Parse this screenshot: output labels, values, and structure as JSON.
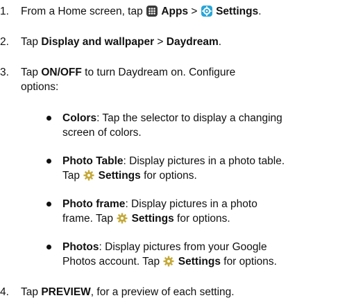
{
  "steps": [
    {
      "num": "1.",
      "parts": {
        "a": "From a Home screen, tap ",
        "apps": "Apps",
        "sep": " > ",
        "settings": "Settings",
        "end": "."
      }
    },
    {
      "num": "2.",
      "parts": {
        "a": "Tap ",
        "display": "Display and wallpaper",
        "sep": " > ",
        "daydream": "Daydream",
        "end": "."
      }
    },
    {
      "num": "3.",
      "parts": {
        "a": "Tap ",
        "onoff": "ON/OFF",
        "b": " to turn Daydream on. Configure",
        "c": "options:"
      }
    },
    {
      "num": "4.",
      "parts": {
        "a": "Tap ",
        "preview": "PREVIEW",
        "b": ", for a preview of each setting."
      }
    }
  ],
  "bullets": [
    {
      "term": "Colors",
      "line1": ": Tap the selector to display a changing",
      "line2": "screen of colors."
    },
    {
      "term": "Photo Table",
      "line1": ": Display pictures in a photo table.",
      "pre": "Tap ",
      "settings": "Settings",
      "post": " for options."
    },
    {
      "term": "Photo frame",
      "line1": ": Display pictures in a photo",
      "pre": "frame. Tap ",
      "settings": "Settings",
      "post": " for options."
    },
    {
      "term": "Photos",
      "line1": ": Display pictures from your Google",
      "pre": "Photos account. Tap ",
      "settings": "Settings",
      "post": " for options."
    }
  ],
  "icons": {
    "apps_icon": "apps-grid-icon",
    "settings_icon": "settings-gear-icon",
    "gear_icon": "gear-icon",
    "apps_color": "#3a3a3a",
    "settings_color": "#29a6d8",
    "gear_color": "#c4a93a"
  }
}
